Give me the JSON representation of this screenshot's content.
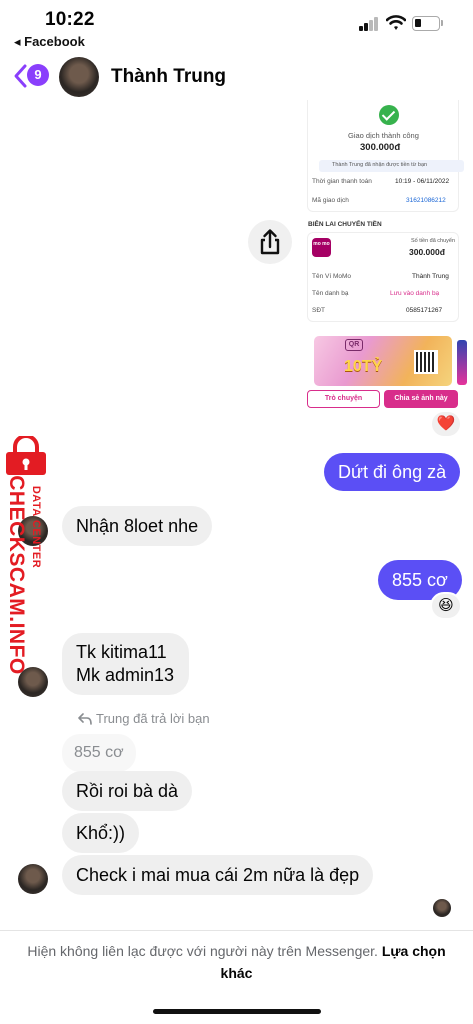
{
  "status_bar": {
    "time": "10:22",
    "back_app": "◂ Facebook",
    "signal_bars": 2,
    "battery_level": 0.2
  },
  "header": {
    "unread_count": "9",
    "contact_name": "Thành Trung"
  },
  "shared_image": {
    "status": "Giao dịch thành công",
    "amount": "300.000đ",
    "notice": "Thành Trung đã nhận được tiền từ bạn",
    "time_label": "Thời gian thanh toán",
    "time_value": "10:19 - 06/11/2022",
    "txn_label": "Mã giao dịch",
    "txn_value": "31621086212",
    "receipt_title": "BIÊN LAI CHUYỂN TIỀN",
    "momo_logo": "mo mo",
    "transferred_label": "Số tiền đã chuyển",
    "transferred_value": "300.000đ",
    "wallet_label": "Tên Ví MoMo",
    "wallet_value": "Thành Trung",
    "contact_label": "Tên danh bạ",
    "contact_value": "Lưu vào danh bạ",
    "phone_label": "SĐT",
    "phone_value": "0585171267",
    "banner_text": "10TỶ",
    "banner_logo": "QR",
    "button_chat": "Trò chuyện",
    "button_share": "Chia sẻ ảnh này"
  },
  "messages": {
    "out_1": "Dứt đi ông zà",
    "in_1": "Nhận 8loet nhe",
    "out_2": "855 cơ",
    "in_2_line1": "Tk kitima11",
    "in_2_line2": "Mk admin13",
    "reply_header": "Trung đã trả lời bạn",
    "quoted": "855 cơ",
    "in_3": "Rồi roi bà dà",
    "in_4": "Khổ:))",
    "in_5": "Check i mai mua cái 2m nữa là đẹp"
  },
  "reactions": {
    "heart": "❤️",
    "laugh": "😆"
  },
  "watermark": {
    "site": "CHECKSCAM.INFO",
    "sub": "DATA CENTER"
  },
  "footer": {
    "text": "Hiện không liên lạc được với người này trên Messenger.",
    "link": "Lựa chọn khác"
  },
  "colors": {
    "accent": "#5b4ff5",
    "badge": "#8a3ffc",
    "watermark": "#e31c23",
    "momo": "#a50064"
  }
}
